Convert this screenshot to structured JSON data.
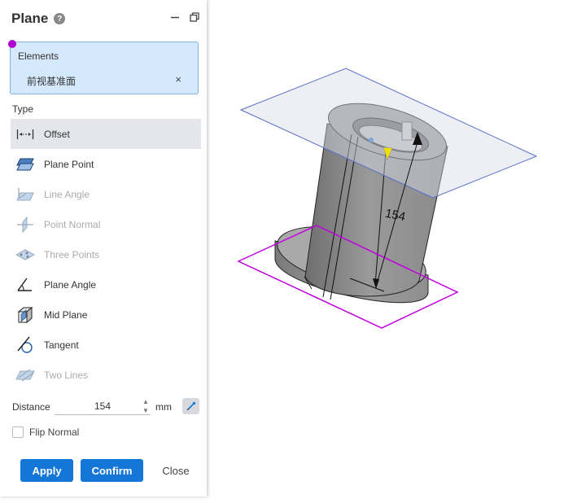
{
  "panel": {
    "title": "Plane",
    "help_icon": "?",
    "minimize_icon": "minimize-icon",
    "restore_icon": "restore-window-icon"
  },
  "elements": {
    "label": "Elements",
    "item": "前视基准面",
    "remove": "×"
  },
  "type": {
    "label": "Type",
    "items": [
      {
        "label": "Offset",
        "icon": "offset-icon",
        "state": "selected"
      },
      {
        "label": "Plane Point",
        "icon": "plane-point-icon",
        "state": "enabled"
      },
      {
        "label": "Line Angle",
        "icon": "line-angle-icon",
        "state": "disabled"
      },
      {
        "label": "Point Normal",
        "icon": "point-normal-icon",
        "state": "disabled"
      },
      {
        "label": "Three Points",
        "icon": "three-points-icon",
        "state": "disabled"
      },
      {
        "label": "Plane Angle",
        "icon": "plane-angle-icon",
        "state": "enabled"
      },
      {
        "label": "Mid Plane",
        "icon": "mid-plane-icon",
        "state": "enabled"
      },
      {
        "label": "Tangent",
        "icon": "tangent-icon",
        "state": "enabled"
      },
      {
        "label": "Two Lines",
        "icon": "two-lines-icon",
        "state": "disabled"
      }
    ]
  },
  "distance": {
    "label": "Distance",
    "value": "154",
    "unit": "mm"
  },
  "flip_normal": {
    "label": "Flip Normal",
    "checked": false
  },
  "buttons": {
    "apply": "Apply",
    "confirm": "Confirm",
    "close": "Close"
  },
  "viewport": {
    "dimension_label": "154",
    "colors": {
      "offset_plane_border": "#5a6ec8",
      "reference_plane_border": "#c000e0",
      "part_body": "#8c8c8c",
      "arrow_yellow": "#f0e000"
    }
  },
  "colors": {
    "accent": "#1476d6",
    "selection_bg": "#d5e9fc"
  }
}
